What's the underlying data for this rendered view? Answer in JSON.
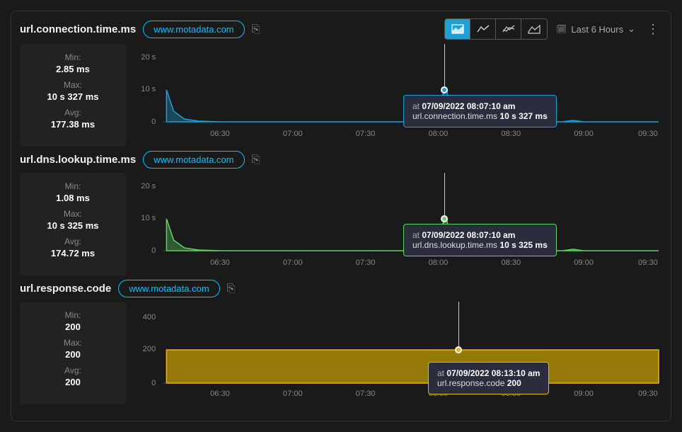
{
  "header": {
    "time_range": "Last 6 Hours"
  },
  "icons": {
    "copy": "⎘",
    "calendar": "📅",
    "chevron": "⌄",
    "dots": "⋮"
  },
  "charts": [
    {
      "title": "url.connection.time.ms",
      "source": "www.motadata.com",
      "stats": {
        "min_label": "Min:",
        "min": "2.85 ms",
        "max_label": "Max:",
        "max": "10 s 327 ms",
        "avg_label": "Avg:",
        "avg": "177.38 ms"
      },
      "tooltip": {
        "prefix": "at",
        "time": "07/09/2022 08:07:10 am",
        "metric": "url.connection.time.ms",
        "value": "10 s 327 ms"
      },
      "color": "#1e9fd6"
    },
    {
      "title": "url.dns.lookup.time.ms",
      "source": "www.motadata.com",
      "stats": {
        "min_label": "Min:",
        "min": "1.08 ms",
        "max_label": "Max:",
        "max": "10 s 325 ms",
        "avg_label": "Avg:",
        "avg": "174.72 ms"
      },
      "tooltip": {
        "prefix": "at",
        "time": "07/09/2022 08:07:10 am",
        "metric": "url.dns.lookup.time.ms",
        "value": "10 s 325 ms"
      },
      "color": "#5bd65b"
    },
    {
      "title": "url.response.code",
      "source": "www.motadata.com",
      "stats": {
        "min_label": "Min:",
        "min": "200",
        "max_label": "Max:",
        "max": "200",
        "avg_label": "Avg:",
        "avg": "200"
      },
      "tooltip": {
        "prefix": "at",
        "time": "07/09/2022 08:13:10 am",
        "metric": "url.response.code",
        "value": "200"
      },
      "color": "#e6b800"
    }
  ],
  "chart_data": [
    {
      "type": "area",
      "title": "url.connection.time.ms",
      "xlabel": "",
      "ylabel": "",
      "x_ticks": [
        "06:30",
        "07:00",
        "07:30",
        "08:00",
        "08:30",
        "09:00",
        "09:30"
      ],
      "y_ticks_labels": [
        "0",
        "10 s",
        "20 s"
      ],
      "y_ticks_values": [
        0,
        10000,
        20000
      ],
      "ylim": [
        0,
        20000
      ],
      "series": [
        {
          "name": "www.motadata.com",
          "x": [
            "06:10",
            "06:15",
            "06:20",
            "06:25",
            "06:30",
            "07:00",
            "07:30",
            "08:00",
            "08:07",
            "08:15",
            "08:30",
            "09:00",
            "09:03",
            "09:30",
            "09:45"
          ],
          "y": [
            10327,
            4000,
            1000,
            200,
            20,
            20,
            20,
            20,
            10327,
            20,
            20,
            20,
            300,
            20,
            20
          ]
        }
      ],
      "tooltip_point": {
        "x": "08:07:10",
        "y": 10327
      }
    },
    {
      "type": "area",
      "title": "url.dns.lookup.time.ms",
      "xlabel": "",
      "ylabel": "",
      "x_ticks": [
        "06:30",
        "07:00",
        "07:30",
        "08:00",
        "08:30",
        "09:00",
        "09:30"
      ],
      "y_ticks_labels": [
        "0",
        "10 s",
        "20 s"
      ],
      "y_ticks_values": [
        0,
        10000,
        20000
      ],
      "ylim": [
        0,
        20000
      ],
      "series": [
        {
          "name": "www.motadata.com",
          "x": [
            "06:10",
            "06:15",
            "06:20",
            "06:25",
            "06:30",
            "07:00",
            "07:30",
            "08:00",
            "08:07",
            "08:15",
            "08:30",
            "09:00",
            "09:03",
            "09:30",
            "09:45"
          ],
          "y": [
            10325,
            4000,
            1000,
            200,
            20,
            20,
            20,
            20,
            10325,
            20,
            20,
            20,
            300,
            20,
            20
          ]
        }
      ],
      "tooltip_point": {
        "x": "08:07:10",
        "y": 10325
      }
    },
    {
      "type": "area",
      "title": "url.response.code",
      "xlabel": "",
      "ylabel": "",
      "x_ticks": [
        "06:30",
        "07:00",
        "07:30",
        "08:00",
        "08:30",
        "09:00",
        "09:30"
      ],
      "y_ticks_labels": [
        "0",
        "200",
        "400"
      ],
      "y_ticks_values": [
        0,
        200,
        400
      ],
      "ylim": [
        0,
        400
      ],
      "series": [
        {
          "name": "www.motadata.com",
          "x": [
            "06:10",
            "06:30",
            "07:00",
            "07:30",
            "08:00",
            "08:13",
            "08:30",
            "09:00",
            "09:30",
            "09:45"
          ],
          "y": [
            200,
            200,
            200,
            200,
            200,
            200,
            200,
            200,
            200,
            200
          ]
        }
      ],
      "tooltip_point": {
        "x": "08:13:10",
        "y": 200
      }
    }
  ]
}
